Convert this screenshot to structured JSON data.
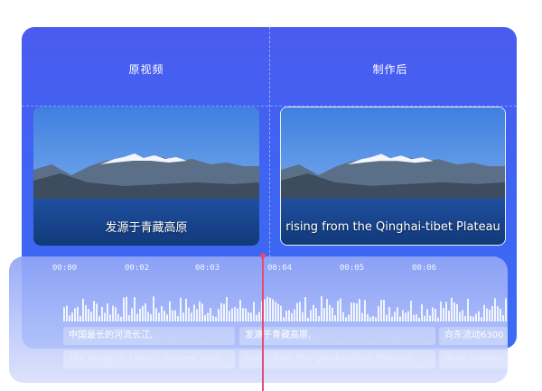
{
  "header": {
    "original_label": "原视频",
    "processed_label": "制作后"
  },
  "preview": {
    "original_subtitle": "发源于青藏高原",
    "processed_subtitle": "rising from the Qinghai-tibet Plateau"
  },
  "timeline": {
    "ticks": [
      "00:00",
      "00:02",
      "00:03",
      "00:04",
      "00:05",
      "00:06"
    ],
    "cues_zh": [
      "中国最长的河流长江,",
      "发源于青藏高原,",
      "向东流动6300"
    ],
    "cues_en": [
      "The Yangtze, china's longest river",
      "rising from the Qinghai-tibet Plateau,",
      "flows eastwa"
    ]
  },
  "colors": {
    "panel": "#4a5cf0",
    "playhead": "#e74a6f"
  }
}
